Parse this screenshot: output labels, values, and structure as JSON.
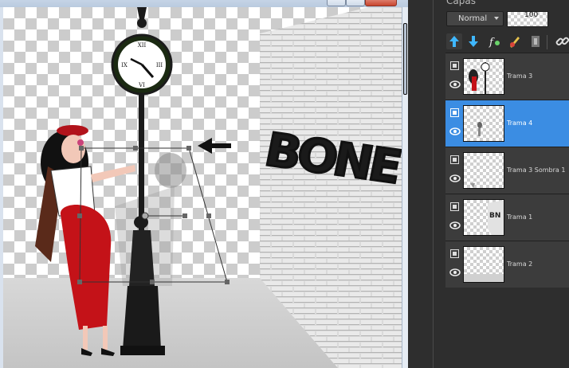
{
  "canvas": {
    "layer_content": "graffiti street scene with woman, street clock and brick wall",
    "graffiti_text": "BONE"
  },
  "layers_panel": {
    "title": "Capas",
    "blend_mode": "Normal",
    "opacity": "100",
    "tools": [
      {
        "icon": "new-layer-up-icon",
        "active": true
      },
      {
        "icon": "move-layer-down-icon",
        "active": false
      },
      {
        "icon": "layer-effects-icon",
        "active": false
      },
      {
        "icon": "paint-brush-icon",
        "active": false
      },
      {
        "icon": "mask-icon",
        "active": false
      },
      {
        "icon": "link-icon",
        "active": false
      }
    ],
    "layers": [
      {
        "name": "Trama 3",
        "selected": false
      },
      {
        "name": "Trama 4",
        "selected": true
      },
      {
        "name": "Trama 3 Sombra 1",
        "selected": false
      },
      {
        "name": "Trama 1",
        "selected": false
      },
      {
        "name": "Trama 2",
        "selected": false
      }
    ]
  },
  "colors": {
    "selection": "#3b8de3",
    "panel_bg": "#2e2e2e",
    "dress_red": "#c41218"
  }
}
